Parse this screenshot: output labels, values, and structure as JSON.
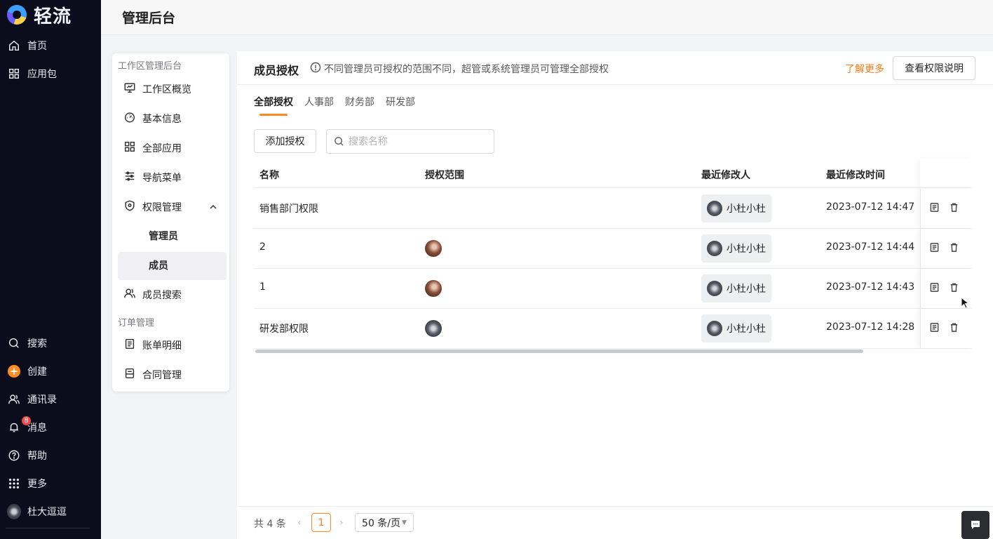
{
  "app": {
    "name": "轻流"
  },
  "leftnav": {
    "top_items": [
      {
        "label": "首页",
        "icon": "home-icon"
      },
      {
        "label": "应用包",
        "icon": "grid-icon"
      }
    ],
    "bottom_items": [
      {
        "label": "搜索",
        "icon": "search-icon"
      },
      {
        "label": "创建",
        "icon": "plus-icon"
      },
      {
        "label": "通讯录",
        "icon": "contacts-icon"
      },
      {
        "label": "消息",
        "icon": "bell-icon",
        "badge": "8"
      },
      {
        "label": "帮助",
        "icon": "help-icon"
      },
      {
        "label": "更多",
        "icon": "apps-icon"
      },
      {
        "label": "杜大逗逗",
        "icon": "user-avatar"
      }
    ]
  },
  "header": {
    "title": "管理后台"
  },
  "subnav": {
    "group1_title": "工作区管理后台",
    "items": [
      {
        "label": "工作区概览",
        "icon": "monitor-icon"
      },
      {
        "label": "基本信息",
        "icon": "dashboard-icon"
      },
      {
        "label": "全部应用",
        "icon": "grid-icon"
      },
      {
        "label": "导航菜单",
        "icon": "sliders-icon"
      },
      {
        "label": "权限管理",
        "icon": "shield-icon"
      }
    ],
    "permission_children": [
      {
        "label": "管理员"
      },
      {
        "label": "成员",
        "active": true
      }
    ],
    "member_search": {
      "label": "成员搜索",
      "icon": "users-icon"
    },
    "group2_title": "订单管理",
    "order_items": [
      {
        "label": "账单明细",
        "icon": "bill-icon"
      },
      {
        "label": "合同管理",
        "icon": "contract-icon"
      }
    ]
  },
  "main": {
    "title": "成员授权",
    "info_text": "不同管理员可授权的范围不同，超管或系统管理员可管理全部授权",
    "learn_more": "了解更多",
    "perm_button": "查看权限说明",
    "tabs": [
      {
        "label": "全部授权",
        "active": true
      },
      {
        "label": "人事部"
      },
      {
        "label": "财务部"
      },
      {
        "label": "研发部"
      }
    ],
    "add_button": "添加授权",
    "search_placeholder": "搜索名称",
    "columns": [
      "名称",
      "授权范围",
      "最近修改人",
      "最近修改时间"
    ],
    "rows": [
      {
        "name": "销售部门权限",
        "scope_avatar": "",
        "modifier": "小杜小杜",
        "time": "2023-07-12 14:47"
      },
      {
        "name": "2",
        "scope_avatar": "warm",
        "modifier": "小杜小杜",
        "time": "2023-07-12 14:44"
      },
      {
        "name": "1",
        "scope_avatar": "warm",
        "modifier": "小杜小杜",
        "time": "2023-07-12 14:43"
      },
      {
        "name": "研发部权限",
        "scope_avatar": "gray",
        "modifier": "小杜小杜",
        "time": "2023-07-12 14:28"
      }
    ],
    "pagination": {
      "total": "共 4 条",
      "current_page": "1",
      "page_size": "50 条/页"
    }
  },
  "colors": {
    "accent": "#ff8a1f",
    "nav_bg": "#0b0d1c",
    "badge": "#f04848"
  }
}
